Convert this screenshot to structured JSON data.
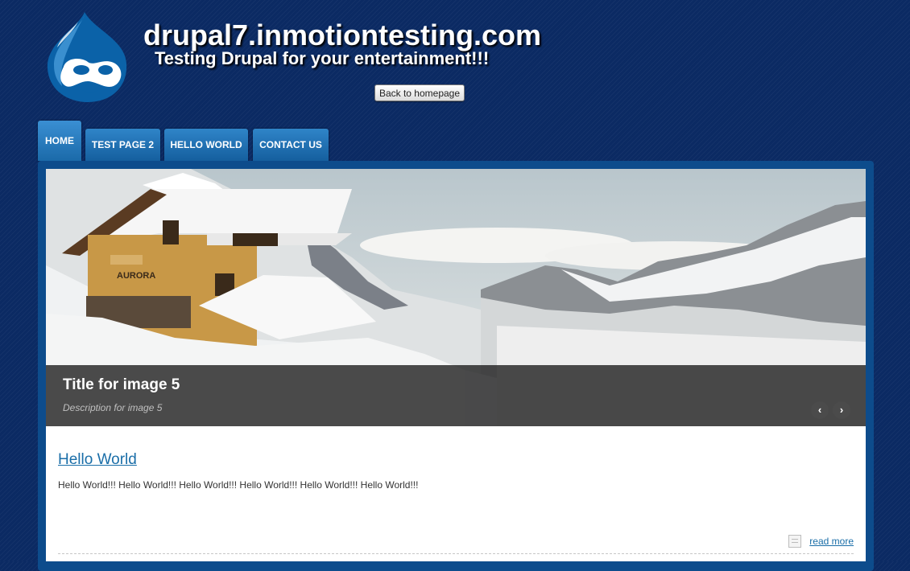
{
  "header": {
    "site_name": "drupal7.inmotiontesting.com",
    "slogan": "Testing Drupal for your entertainment!!!",
    "back_button": "Back to homepage",
    "logo_icon": "drupal-drop-logo"
  },
  "nav": {
    "tabs": [
      {
        "label": "HOME",
        "active": true
      },
      {
        "label": "TEST PAGE 2",
        "active": false
      },
      {
        "label": "HELLO WORLD",
        "active": false
      },
      {
        "label": "CONTACT US",
        "active": false
      }
    ]
  },
  "slider": {
    "caption_title": "Title for image 5",
    "caption_description": "Description for image 5",
    "house_sign": "AURORA",
    "prev_icon": "‹",
    "next_icon": "›"
  },
  "node": {
    "title": "Hello World",
    "body": "Hello World!!! Hello World!!! Hello World!!! Hello World!!! Hello World!!! Hello World!!!",
    "read_more": "read more"
  },
  "colors": {
    "background": "#0b2a63",
    "tab": "#1f74b8",
    "panel": "#0d4c8c",
    "link": "#1a6ea8"
  }
}
